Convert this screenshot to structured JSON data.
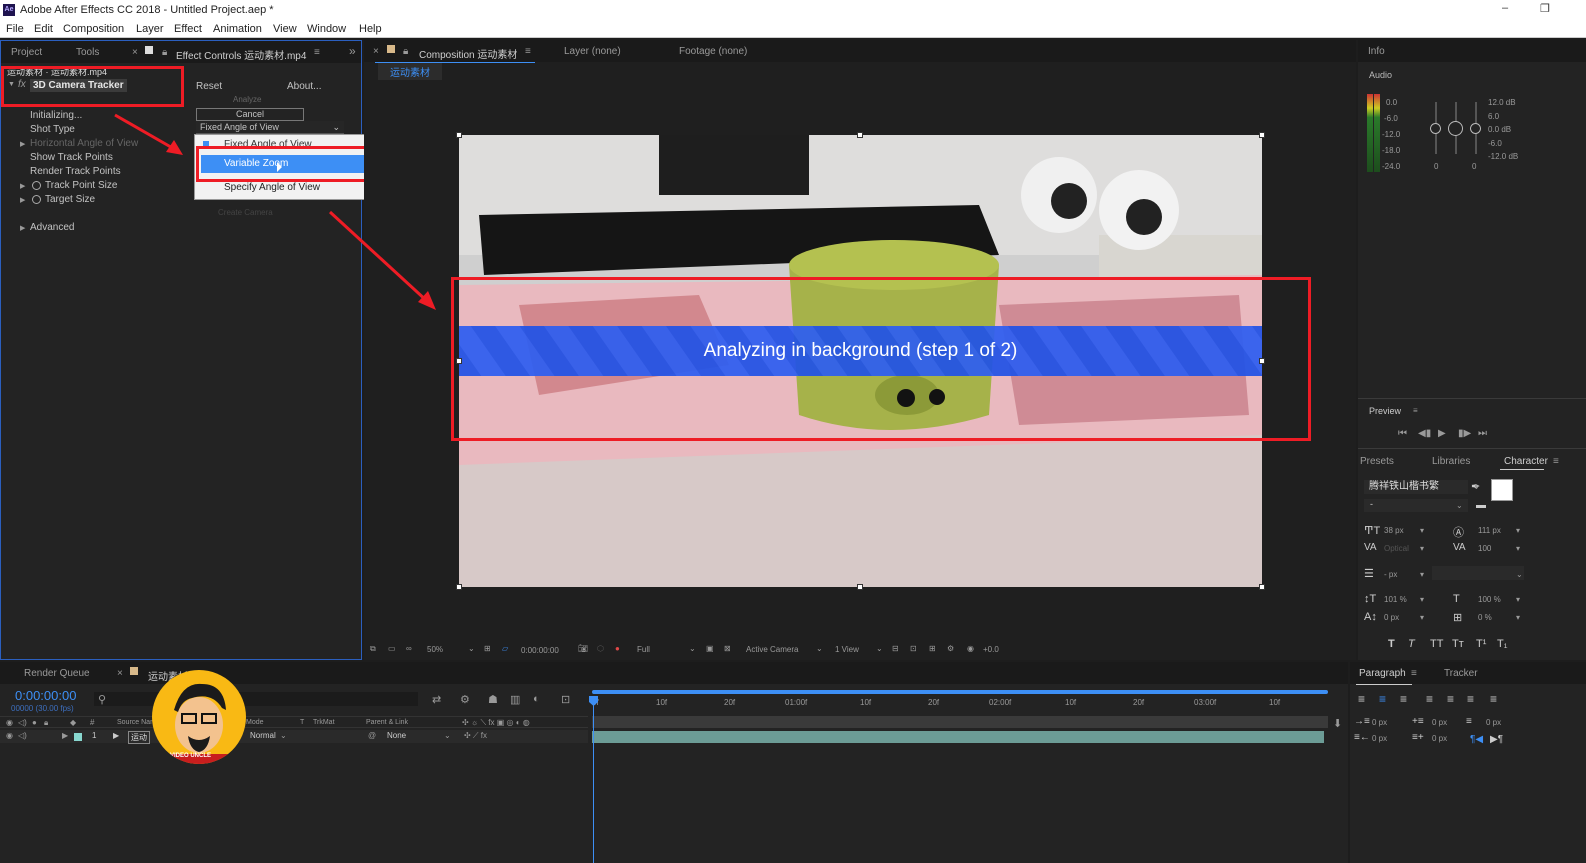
{
  "window": {
    "title": "Adobe After Effects CC 2018 - Untitled Project.aep *",
    "app_badge": "Ae",
    "minimize": "–",
    "restore": "❐"
  },
  "menu": [
    "File",
    "Edit",
    "Composition",
    "Layer",
    "Effect",
    "Animation",
    "View",
    "Window",
    "Help"
  ],
  "left_panel": {
    "tabs": [
      "Project",
      "Tools"
    ],
    "effect_tab": "Effect Controls 运动素材.mp4",
    "layer_breadcrumb": "运动素材 · 运动素材.mp4",
    "effect_name": "3D Camera Tracker",
    "fx": "fx",
    "reset": "Reset",
    "about": "About...",
    "analyze_label": "Analyze",
    "cancel_label": "Cancel",
    "status": "Initializing...",
    "shot_type_label": "Shot Type",
    "shot_type_value": "Fixed Angle of View",
    "horizontal_aov": "Horizontal Angle of View",
    "show_track_points": "Show Track Points",
    "render_track_points": "Render Track Points",
    "track_point_size": "Track Point Size",
    "target_size": "Target Size",
    "create_camera": "Create Camera",
    "advanced": "Advanced",
    "dropdown_options": [
      "Fixed Angle of View",
      "Variable Zoom",
      "Specify Angle of View"
    ],
    "dropdown_highlighted": "Variable Zoom"
  },
  "comp_panel": {
    "comp_tab": "Composition 运动素材",
    "layer_tab": "Layer (none)",
    "footage_tab": "Footage (none)",
    "comp_name_chip": "运动素材",
    "overlay_text": "Analyzing in background (step 1 of 2)",
    "toolbar": {
      "zoom": "50%",
      "timecode": "0:00:00:00",
      "resolution": "Full",
      "camera": "Active Camera",
      "views": "1 View",
      "exposure": "+0.0"
    }
  },
  "right_panel": {
    "info_tab": "Info",
    "audio_label": "Audio",
    "audio_left_scale": [
      "0.0",
      "-6.0",
      "-12.0",
      "-18.0",
      "-24.0"
    ],
    "audio_right_scale": [
      "12.0 dB",
      "6.0",
      "0.0 dB",
      "-6.0",
      "-12.0 dB"
    ],
    "audio_zero_left": "0",
    "audio_zero_right": "0",
    "preview_label": "Preview",
    "tabs": [
      "Presets",
      "Libraries",
      "Character"
    ],
    "font_name": "腾祥铁山楷书繁",
    "font_style": "-",
    "font_size": "38 px",
    "leading": "111 px",
    "kerning": "Optical",
    "tracking": "100",
    "stroke_width": "- px",
    "vert_scale": "101 %",
    "horiz_scale": "100 %",
    "baseline": "0 px",
    "tsume": "0 %",
    "type_style_buttons": [
      "T",
      "T",
      "TT",
      "Tт",
      "T¹",
      "T₁"
    ]
  },
  "timeline": {
    "render_queue": "Render Queue",
    "comp_tab": "运动素材",
    "timecode": "0:00:00:00",
    "fps": "00000 (30.00 fps)",
    "columns": [
      "Source Name",
      "Mode",
      "T",
      "TrkMat",
      "Parent & Link"
    ],
    "layer_number": "1",
    "layer_name": "运动",
    "layer_mode": "Normal",
    "parent": "None",
    "ruler": [
      "0f",
      "10f",
      "20f",
      "01:00f",
      "10f",
      "20f",
      "02:00f",
      "10f",
      "20f",
      "03:00f",
      "10f"
    ],
    "watermark": "VIDEO UNCLE"
  },
  "para_panel": {
    "tabs": [
      "Paragraph",
      "Tracker"
    ],
    "values": [
      "0 px",
      "0 px",
      "0 px",
      "0 px",
      "0 px"
    ]
  },
  "colors": {
    "accent": "#3d8ff5",
    "annotation_red": "#ee1c25",
    "panel_bg": "#232323"
  }
}
